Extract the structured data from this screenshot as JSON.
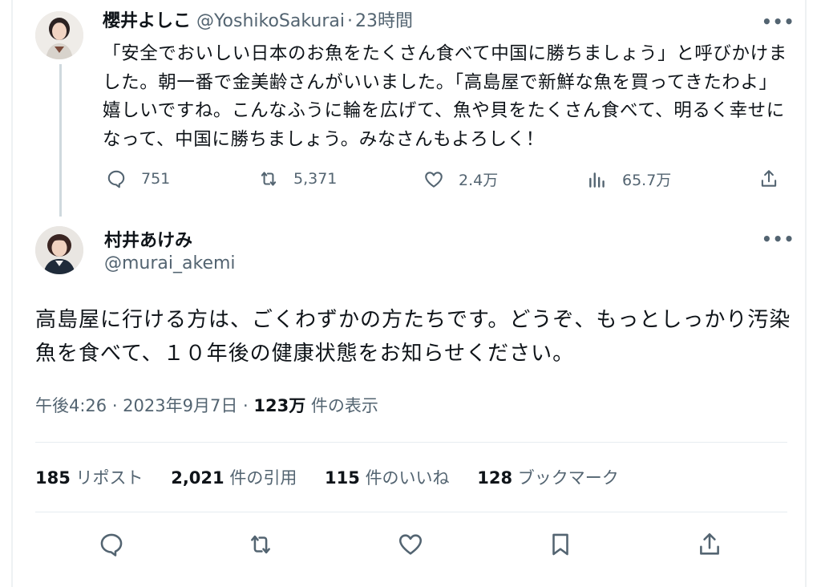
{
  "reply_to": {
    "name": "櫻井よしこ",
    "handle": "@YoshikoSakurai",
    "separator": "·",
    "time": "23時間",
    "text": "「安全でおいしい日本のお魚をたくさん食べて中国に勝ちましょう」と呼びかけました。朝一番で金美齢さんがいいました。「高島屋で新鮮な魚を買ってきたわよ」嬉しいですね。こんなふうに輪を広げて、魚や貝をたくさん食べて、明るく幸せになって、中国に勝ちましょう。みなさんもよろしく！",
    "replies": "751",
    "reposts": "5,371",
    "likes": "2.4万",
    "views": "65.7万"
  },
  "tweet": {
    "name": "村井あけみ",
    "handle": "@murai_akemi",
    "text": "高島屋に行ける方は、ごくわずかの方たちです。どうぞ、もっとしっかり汚染魚を食べて、１０年後の健康状態をお知らせください。",
    "time": "午後4:26 · 2023年9月7日 ·",
    "views_count": "123万",
    "views_label": "件の表示",
    "reposts_count": "185",
    "reposts_label": "リポスト",
    "quotes_count": "2,021",
    "quotes_label": "件の引用",
    "likes_count": "115",
    "likes_label": "件のいいね",
    "bookmarks_count": "128",
    "bookmarks_label": "ブックマーク"
  },
  "icons": {
    "more": "more-icon",
    "reply": "reply-icon",
    "repost": "repost-icon",
    "like": "like-icon",
    "views": "views-icon",
    "share": "share-icon",
    "bookmark": "bookmark-icon"
  },
  "colors": {
    "text": "#0f1419",
    "muted": "#536471",
    "divider": "#e6ecf0",
    "thread_line": "#cfd9de"
  }
}
